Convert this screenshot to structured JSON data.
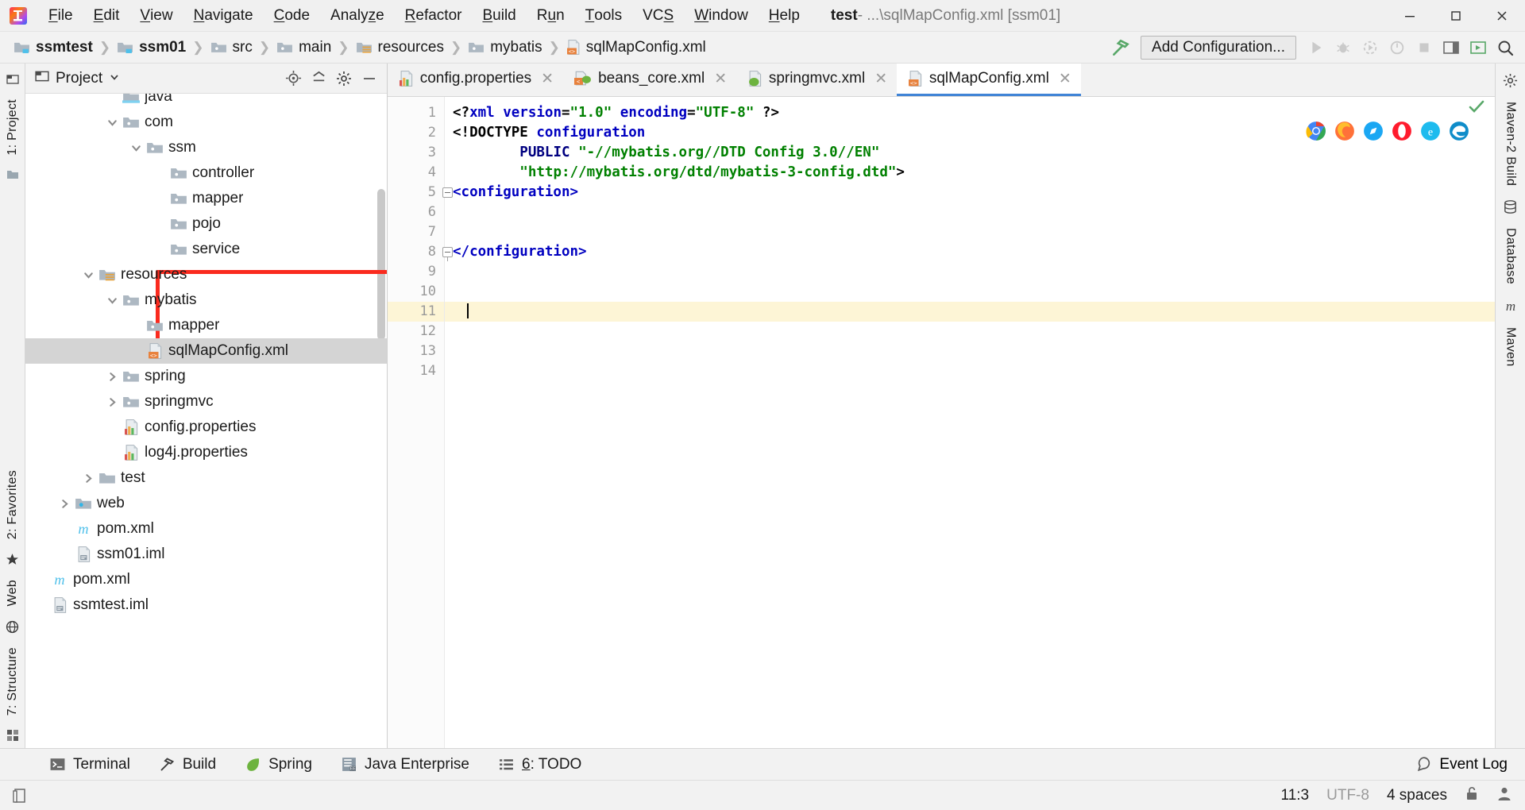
{
  "window": {
    "title_project": "test",
    "title_rest": " - ...\\sqlMapConfig.xml [ssm01]",
    "minimize_label": "minimize-button",
    "maximize_label": "maximize-button",
    "close_label": "close-button"
  },
  "menubar": {
    "items": [
      {
        "label": "File",
        "mnemonic": "F"
      },
      {
        "label": "Edit",
        "mnemonic": "E"
      },
      {
        "label": "View",
        "mnemonic": "V"
      },
      {
        "label": "Navigate",
        "mnemonic": "N"
      },
      {
        "label": "Code",
        "mnemonic": "C"
      },
      {
        "label": "Analyze",
        "mnemonic": "z"
      },
      {
        "label": "Refactor",
        "mnemonic": "R"
      },
      {
        "label": "Build",
        "mnemonic": "B"
      },
      {
        "label": "Run",
        "mnemonic": "u"
      },
      {
        "label": "Tools",
        "mnemonic": "T"
      },
      {
        "label": "VCS",
        "mnemonic": "S"
      },
      {
        "label": "Window",
        "mnemonic": "W"
      },
      {
        "label": "Help",
        "mnemonic": "H"
      }
    ]
  },
  "breadcrumb": {
    "items": [
      {
        "label": "ssmtest",
        "icon": "module-icon",
        "bold": true
      },
      {
        "label": "ssm01",
        "icon": "module-icon",
        "bold": true
      },
      {
        "label": "src",
        "icon": "folder-icon",
        "bold": false
      },
      {
        "label": "main",
        "icon": "folder-icon",
        "bold": false
      },
      {
        "label": "resources",
        "icon": "resources-folder-icon",
        "bold": false
      },
      {
        "label": "mybatis",
        "icon": "folder-icon",
        "bold": false
      },
      {
        "label": "sqlMapConfig.xml",
        "icon": "xml-file-icon",
        "bold": false
      }
    ]
  },
  "toolbar": {
    "build_icon": "hammer-icon",
    "add_configuration_label": "Add Configuration...",
    "run_icon": "run-icon",
    "debug_icon": "debug-icon",
    "run_coverage_icon": "run-with-coverage-icon",
    "profile_icon": "profile-icon",
    "stop_icon": "stop-icon",
    "layout_icon": "layout-icon",
    "run_anything_icon": "run-anything-icon",
    "search_icon": "search-everywhere-icon"
  },
  "project_panel": {
    "title": "Project",
    "dropdown_icon": "chevron-down-icon",
    "actions": [
      {
        "name": "locate-icon"
      },
      {
        "name": "collapse-all-icon"
      },
      {
        "name": "settings-gear-icon"
      },
      {
        "name": "hide-icon"
      }
    ],
    "tree": [
      {
        "label": "java",
        "depth": 3,
        "arrow": "none",
        "icon": "source-folder-icon",
        "partial": true
      },
      {
        "label": "com",
        "depth": 3,
        "arrow": "down",
        "icon": "folder-icon"
      },
      {
        "label": "ssm",
        "depth": 4,
        "arrow": "down",
        "icon": "folder-icon"
      },
      {
        "label": "controller",
        "depth": 5,
        "arrow": "none",
        "icon": "folder-icon"
      },
      {
        "label": "mapper",
        "depth": 5,
        "arrow": "none",
        "icon": "folder-icon"
      },
      {
        "label": "pojo",
        "depth": 5,
        "arrow": "none",
        "icon": "folder-icon"
      },
      {
        "label": "service",
        "depth": 5,
        "arrow": "none",
        "icon": "folder-icon"
      },
      {
        "label": "resources",
        "depth": 2,
        "arrow": "down",
        "icon": "resources-folder-icon"
      },
      {
        "label": "mybatis",
        "depth": 3,
        "arrow": "down",
        "icon": "folder-icon"
      },
      {
        "label": "mapper",
        "depth": 4,
        "arrow": "none",
        "icon": "folder-icon"
      },
      {
        "label": "sqlMapConfig.xml",
        "depth": 4,
        "arrow": "none",
        "icon": "xml-file-icon",
        "selected": true
      },
      {
        "label": "spring",
        "depth": 3,
        "arrow": "right",
        "icon": "folder-icon"
      },
      {
        "label": "springmvc",
        "depth": 3,
        "arrow": "right",
        "icon": "folder-icon"
      },
      {
        "label": "config.properties",
        "depth": 3,
        "arrow": "none",
        "icon": "properties-file-icon"
      },
      {
        "label": "log4j.properties",
        "depth": 3,
        "arrow": "none",
        "icon": "properties-file-icon"
      },
      {
        "label": "test",
        "depth": 2,
        "arrow": "right",
        "icon": "test-folder-icon"
      },
      {
        "label": "web",
        "depth": 1,
        "arrow": "right",
        "icon": "web-folder-icon"
      },
      {
        "label": "pom.xml",
        "depth": 1,
        "arrow": "none",
        "icon": "maven-icon"
      },
      {
        "label": "ssm01.iml",
        "depth": 1,
        "arrow": "none",
        "icon": "iml-file-icon"
      },
      {
        "label": "pom.xml",
        "depth": 0,
        "arrow": "none",
        "icon": "maven-icon"
      },
      {
        "label": "ssmtest.iml",
        "depth": 0,
        "arrow": "none",
        "icon": "iml-file-icon"
      }
    ]
  },
  "left_rail": {
    "items": [
      {
        "label": "1: Project",
        "icon": "project-icon"
      },
      {
        "label": "2: Favorites",
        "icon": "favorites-icon"
      },
      {
        "label": "Web",
        "icon": "web-icon"
      },
      {
        "label": "7: Structure",
        "icon": "structure-icon"
      }
    ]
  },
  "right_rail": {
    "items": [
      {
        "label": "Maven-2 Build",
        "icon": "maven-build-icon"
      },
      {
        "label": "Database",
        "icon": "database-icon"
      },
      {
        "label": "Maven",
        "icon": "maven-m-icon"
      }
    ]
  },
  "editor": {
    "tabs": [
      {
        "label": "config.properties",
        "icon": "properties-file-icon",
        "active": false
      },
      {
        "label": "beans_core.xml",
        "icon": "spring-bean-icon",
        "active": false
      },
      {
        "label": "springmvc.xml",
        "icon": "spring-mvc-icon",
        "active": false
      },
      {
        "label": "sqlMapConfig.xml",
        "icon": "xml-file-icon",
        "active": true
      }
    ],
    "line_numbers": [
      "1",
      "2",
      "3",
      "4",
      "5",
      "6",
      "7",
      "8",
      "9",
      "10",
      "11",
      "12",
      "13",
      "14"
    ],
    "current_line": 11,
    "lines": [
      {
        "n": 1,
        "tokens": [
          {
            "t": "<?",
            "c": "punct"
          },
          {
            "t": "xml",
            "c": "tag"
          },
          {
            "t": " ",
            "c": "punct"
          },
          {
            "t": "version",
            "c": "attr"
          },
          {
            "t": "=",
            "c": "punct"
          },
          {
            "t": "\"1.0\"",
            "c": "val"
          },
          {
            "t": " ",
            "c": "punct"
          },
          {
            "t": "encoding",
            "c": "attr"
          },
          {
            "t": "=",
            "c": "punct"
          },
          {
            "t": "\"UTF-8\"",
            "c": "val"
          },
          {
            "t": " ?>",
            "c": "punct"
          }
        ]
      },
      {
        "n": 2,
        "tokens": [
          {
            "t": "<!DOCTYPE",
            "c": "punct"
          },
          {
            "t": " ",
            "c": "punct"
          },
          {
            "t": "configuration",
            "c": "tag"
          }
        ]
      },
      {
        "n": 3,
        "tokens": [
          {
            "t": "        ",
            "c": "punct"
          },
          {
            "t": "PUBLIC",
            "c": "kw"
          },
          {
            "t": " ",
            "c": "punct"
          },
          {
            "t": "\"-//mybatis.org//DTD Config 3.0//EN\"",
            "c": "val"
          }
        ]
      },
      {
        "n": 4,
        "tokens": [
          {
            "t": "        ",
            "c": "punct"
          },
          {
            "t": "\"http://mybatis.org/dtd/mybatis-3-config.dtd\"",
            "c": "val"
          },
          {
            "t": ">",
            "c": "punct"
          }
        ]
      },
      {
        "n": 5,
        "tokens": [
          {
            "t": "<configuration>",
            "c": "tag"
          }
        ],
        "fold": "start"
      },
      {
        "n": 6,
        "tokens": []
      },
      {
        "n": 7,
        "tokens": []
      },
      {
        "n": 8,
        "tokens": [
          {
            "t": "</configuration>",
            "c": "tag"
          }
        ],
        "fold": "end"
      },
      {
        "n": 9,
        "tokens": []
      },
      {
        "n": 10,
        "tokens": []
      },
      {
        "n": 11,
        "tokens": [],
        "caret": true
      },
      {
        "n": 12,
        "tokens": []
      },
      {
        "n": 13,
        "tokens": []
      },
      {
        "n": 14,
        "tokens": []
      }
    ],
    "inspection_status": "ok-check-icon",
    "browsers": [
      "chrome-icon",
      "firefox-icon",
      "safari-icon",
      "opera-icon",
      "ie-icon",
      "edge-icon"
    ]
  },
  "bottom_bar": {
    "items": [
      {
        "label": "Terminal",
        "icon": "terminal-icon"
      },
      {
        "label": "Build",
        "icon": "hammer-icon"
      },
      {
        "label": "Spring",
        "icon": "spring-leaf-icon"
      },
      {
        "label": "Java Enterprise",
        "icon": "java-enterprise-icon"
      },
      {
        "label": "6: TODO",
        "icon": "todo-list-icon"
      }
    ],
    "event_log": {
      "label": "Event Log",
      "icon": "event-log-icon"
    }
  },
  "statusbar": {
    "left_icon": "toggle-sidebar-icon",
    "caret_position": "11:3",
    "encoding": "UTF-8",
    "indent": "4 spaces",
    "lock_icon": "unlocked-icon",
    "user_icon": "user-avatar-icon"
  },
  "colors": {
    "accent": "#4084d6",
    "annotation_red": "#fa2a1e",
    "selection_gray": "#d4d4d4",
    "current_line": "#fdf5d6",
    "xml_tag": "#0000c0",
    "xml_value": "#008000"
  }
}
